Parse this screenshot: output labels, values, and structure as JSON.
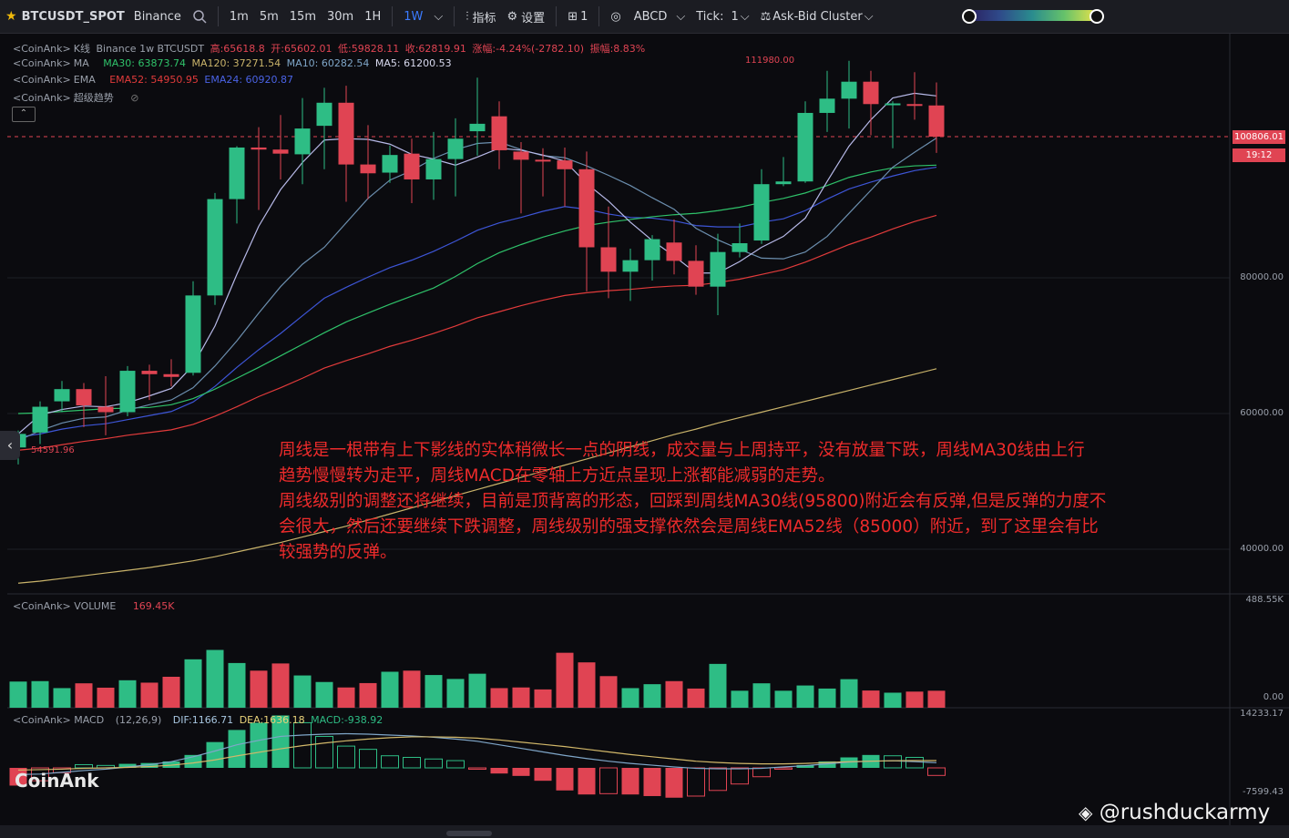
{
  "toolbar": {
    "symbol": "BTCUSDT_SPOT",
    "exchange": "Binance",
    "intervals": [
      "1m",
      "5m",
      "15m",
      "30m",
      "1H",
      "1W"
    ],
    "active_interval": "1W",
    "indicators_label": "指标",
    "settings_label": "设置",
    "layout_count": "1",
    "drawing_label": "ABCD",
    "tick_label": "Tick:",
    "tick_value": "1",
    "cluster_label": "Ask-Bid Cluster"
  },
  "legend": {
    "kline": {
      "prefix": "<CoinAnk>",
      "name": "K线",
      "desc": "Binance 1w BTCUSDT",
      "high": "高:65618.8",
      "open": "开:65602.01",
      "low": "低:59828.11",
      "close": "收:62819.91",
      "change": "涨幅:-4.24%(-2782.10)",
      "amp": "振幅:8.83%"
    },
    "ma": {
      "prefix": "<CoinAnk>",
      "name": "MA",
      "ma30": "MA30: 63873.74",
      "ma120": "MA120: 37271.54",
      "ma10": "MA10: 60282.54",
      "ma5": "MA5: 61200.53"
    },
    "ema": {
      "prefix": "<CoinAnk>",
      "name": "EMA",
      "ema52": "EMA52: 54950.95",
      "ema24": "EMA24: 60920.87"
    },
    "supertrend": {
      "prefix": "<CoinAnk>",
      "name": "超级趋势"
    }
  },
  "colors": {
    "up": "#2ebd85",
    "down": "#e04453",
    "ma5": "#b7b9e8",
    "ma10": "#6c8faf",
    "ma30": "#2fc26a",
    "ma120": "#c9b36a",
    "ema52": "#e23b3b",
    "ema24": "#3d55d6",
    "dif": "#7fa6c8",
    "dea": "#d2b86a"
  },
  "price_axis": {
    "labels": [
      "80000.00",
      "60000.00",
      "40000.00"
    ],
    "current_price": "100806.01",
    "countdown": "19:12",
    "high_marker": "111980.00",
    "low_marker": "54591.96"
  },
  "volume": {
    "label": "<CoinAnk> VOLUME",
    "value": "169.45K",
    "axis_top": "488.55K",
    "axis_bottom": "0.00"
  },
  "macd": {
    "label": "<CoinAnk> MACD",
    "params": "(12,26,9)",
    "dif": "DIF:1166.71",
    "dea": "DEA:1636.18",
    "macd": "MACD:-938.92",
    "axis_top": "14233.17",
    "axis_bottom": "-7599.43"
  },
  "watermark": "CoinAnk",
  "credit": "@rushduckarmy",
  "note": [
    "周线是一根带有上下影线的实体稍微长一点的阴线，成交量与上周持平，没有放量下跌，周线MA30线由上行",
    "趋势慢慢转为走平，周线MACD在零轴上方近点呈现上涨都能减弱的走势。",
    "周线级别的调整还将继续，目前是顶背离的形态，回踩到周线MA30线(95800)附近会有反弹,但是反弹的力度不",
    "会很大，然后还要继续下跌调整，周线级别的强支撑依然会是周线EMA52线（85000）附近，到了这里会有比",
    "较强势的反弹。"
  ],
  "chart_data": {
    "type": "candlestick",
    "price_range": [
      28000,
      115000
    ],
    "candles": [
      {
        "o": 55000,
        "h": 57500,
        "l": 52500,
        "c": 57000
      },
      {
        "o": 57200,
        "h": 61800,
        "l": 55500,
        "c": 61000
      },
      {
        "o": 61800,
        "h": 64800,
        "l": 60200,
        "c": 63600
      },
      {
        "o": 63600,
        "h": 64500,
        "l": 58000,
        "c": 61200
      },
      {
        "o": 61000,
        "h": 65500,
        "l": 56800,
        "c": 60200
      },
      {
        "o": 60200,
        "h": 67000,
        "l": 59600,
        "c": 66300
      },
      {
        "o": 66300,
        "h": 67200,
        "l": 62000,
        "c": 65800
      },
      {
        "o": 65800,
        "h": 68000,
        "l": 64000,
        "c": 65400
      },
      {
        "o": 66000,
        "h": 79500,
        "l": 65600,
        "c": 77400
      },
      {
        "o": 77400,
        "h": 92500,
        "l": 76000,
        "c": 91600
      },
      {
        "o": 91600,
        "h": 99400,
        "l": 88000,
        "c": 99200
      },
      {
        "o": 99200,
        "h": 102200,
        "l": 90000,
        "c": 98900
      },
      {
        "o": 98900,
        "h": 104000,
        "l": 94500,
        "c": 98300
      },
      {
        "o": 98200,
        "h": 106500,
        "l": 93800,
        "c": 102000
      },
      {
        "o": 102400,
        "h": 108000,
        "l": 96000,
        "c": 105800
      },
      {
        "o": 105800,
        "h": 108300,
        "l": 91200,
        "c": 96700
      },
      {
        "o": 96700,
        "h": 102500,
        "l": 91600,
        "c": 95400
      },
      {
        "o": 95500,
        "h": 99500,
        "l": 94000,
        "c": 98100
      },
      {
        "o": 98300,
        "h": 100500,
        "l": 91000,
        "c": 94500
      },
      {
        "o": 94500,
        "h": 101500,
        "l": 91500,
        "c": 97500
      },
      {
        "o": 97500,
        "h": 103500,
        "l": 92000,
        "c": 100500
      },
      {
        "o": 101600,
        "h": 109500,
        "l": 98000,
        "c": 102700
      },
      {
        "o": 103800,
        "h": 106000,
        "l": 96000,
        "c": 98800
      },
      {
        "o": 98600,
        "h": 100000,
        "l": 89500,
        "c": 97400
      },
      {
        "o": 97400,
        "h": 99100,
        "l": 92000,
        "c": 97300
      },
      {
        "o": 97300,
        "h": 99200,
        "l": 90500,
        "c": 96000
      },
      {
        "o": 96000,
        "h": 98600,
        "l": 78000,
        "c": 84500
      },
      {
        "o": 84500,
        "h": 90500,
        "l": 77000,
        "c": 80900
      },
      {
        "o": 80900,
        "h": 84300,
        "l": 76600,
        "c": 82600
      },
      {
        "o": 82600,
        "h": 86300,
        "l": 79600,
        "c": 85700
      },
      {
        "o": 85200,
        "h": 88600,
        "l": 80500,
        "c": 82500
      },
      {
        "o": 82500,
        "h": 84800,
        "l": 77500,
        "c": 78700
      },
      {
        "o": 78700,
        "h": 86500,
        "l": 74500,
        "c": 83800
      },
      {
        "o": 83800,
        "h": 88000,
        "l": 83000,
        "c": 85100
      },
      {
        "o": 85500,
        "h": 96000,
        "l": 85000,
        "c": 93800
      },
      {
        "o": 93800,
        "h": 97800,
        "l": 93500,
        "c": 94200
      },
      {
        "o": 94200,
        "h": 106000,
        "l": 94000,
        "c": 104300
      },
      {
        "o": 104300,
        "h": 110500,
        "l": 101500,
        "c": 106400
      },
      {
        "o": 106400,
        "h": 111980,
        "l": 102000,
        "c": 108900
      },
      {
        "o": 108900,
        "h": 110500,
        "l": 101000,
        "c": 105600
      },
      {
        "o": 105600,
        "h": 106000,
        "l": 99100,
        "c": 105700
      },
      {
        "o": 105600,
        "h": 110300,
        "l": 103300,
        "c": 105400
      },
      {
        "o": 105400,
        "h": 108800,
        "l": 98400,
        "c": 100806
      }
    ],
    "ma5": [
      57000,
      59800,
      60600,
      61100,
      61000,
      61600,
      62600,
      63700,
      67100,
      72900,
      80500,
      87600,
      93000,
      97000,
      100300,
      100500,
      100400,
      99700,
      98200,
      97500,
      96600,
      97800,
      99100,
      98800,
      98100,
      97200,
      93900,
      91300,
      88200,
      85500,
      83200,
      80700,
      80700,
      82400,
      84500,
      86100,
      88800,
      94200,
      99400,
      103300,
      106500,
      107200,
      106800
    ],
    "ma10": [
      56000,
      57500,
      58600,
      59300,
      59500,
      60500,
      61300,
      62000,
      63800,
      67000,
      70700,
      74800,
      78700,
      82000,
      84500,
      88100,
      91700,
      94400,
      95800,
      97600,
      98900,
      99800,
      100000,
      98900,
      98000,
      97700,
      96500,
      95100,
      93600,
      91800,
      90100,
      87300,
      85600,
      84200,
      82900,
      82800,
      83800,
      86100,
      89500,
      92900,
      96300,
      98500,
      100600
    ],
    "ma30": [
      60000,
      60100,
      60300,
      60500,
      60700,
      60800,
      60900,
      61300,
      62200,
      63600,
      65200,
      66800,
      68500,
      70200,
      71900,
      73500,
      74800,
      76100,
      77300,
      78500,
      80200,
      82100,
      83700,
      84900,
      86000,
      86900,
      87700,
      88200,
      88600,
      89000,
      89300,
      89500,
      89900,
      90400,
      91100,
      91700,
      92500,
      93600,
      94800,
      95600,
      96200,
      96500,
      96600
    ],
    "ma120": [
      35000,
      35300,
      35700,
      36100,
      36500,
      36900,
      37300,
      37800,
      38300,
      38900,
      39600,
      40300,
      41000,
      41800,
      42600,
      43400,
      44300,
      45200,
      46100,
      47000,
      47900,
      48800,
      49700,
      50600,
      51500,
      52400,
      53300,
      54200,
      55100,
      56000,
      56900,
      57700,
      58600,
      59400,
      60200,
      61000,
      61800,
      62600,
      63400,
      64200,
      65000,
      65800,
      66600
    ],
    "ema52": [
      54600,
      54900,
      55400,
      55900,
      56300,
      56800,
      57200,
      57600,
      58400,
      59600,
      61000,
      62500,
      63800,
      65200,
      66700,
      67800,
      68800,
      69900,
      70800,
      71800,
      72900,
      74100,
      75000,
      75900,
      76700,
      77400,
      77800,
      78100,
      78300,
      78600,
      78800,
      78900,
      79300,
      79800,
      80500,
      81200,
      82300,
      83600,
      84900,
      86000,
      87200,
      88300,
      89200
    ],
    "ema24": [
      56500,
      57000,
      57700,
      58200,
      58500,
      59100,
      59700,
      60300,
      61700,
      64000,
      66800,
      69400,
      71800,
      74400,
      77000,
      78600,
      80100,
      81500,
      82600,
      83900,
      85400,
      87000,
      88100,
      88900,
      89800,
      90500,
      90100,
      89400,
      88900,
      88800,
      88400,
      87700,
      87500,
      87500,
      88200,
      88700,
      89900,
      91600,
      93100,
      94100,
      95000,
      95800,
      96300
    ],
    "volume": [
      120000,
      122000,
      90000,
      112000,
      92000,
      126000,
      115000,
      142000,
      222000,
      265000,
      205000,
      170000,
      203000,
      148000,
      118000,
      93000,
      113000,
      165000,
      170000,
      150000,
      132000,
      156000,
      90000,
      93000,
      84000,
      252000,
      208000,
      145000,
      90000,
      108000,
      122000,
      88000,
      201000,
      78000,
      112000,
      78000,
      102000,
      88000,
      131000,
      79000,
      69000,
      74000,
      78000
    ],
    "macd_hist": [
      -2200,
      -1600,
      -600,
      400,
      300,
      500,
      600,
      800,
      1600,
      3200,
      4700,
      5600,
      6500,
      5600,
      3900,
      2700,
      2300,
      1500,
      1300,
      1100,
      900,
      -150,
      -700,
      -1000,
      -1600,
      -2800,
      -3300,
      -3200,
      -3300,
      -3500,
      -3700,
      -3500,
      -2800,
      -2000,
      -1100,
      -150,
      350,
      800,
      1300,
      1600,
      1500,
      1300,
      -939
    ],
    "dif": [
      -1500,
      -1400,
      -1000,
      -600,
      -300,
      200,
      700,
      1400,
      2500,
      3800,
      5200,
      6200,
      7100,
      7400,
      7600,
      7700,
      7600,
      7400,
      7200,
      6900,
      6500,
      6000,
      5200,
      4400,
      3600,
      2800,
      2100,
      1500,
      1000,
      600,
      200,
      -100,
      -200,
      -200,
      -100,
      200,
      500,
      900,
      1300,
      1500,
      1600,
      1400,
      1167
    ],
    "dea": [
      -500,
      -400,
      -300,
      -100,
      0,
      100,
      300,
      600,
      1100,
      1800,
      2700,
      3500,
      4300,
      5000,
      5600,
      6100,
      6500,
      6800,
      7000,
      7000,
      6900,
      6700,
      6300,
      5800,
      5300,
      4800,
      4200,
      3600,
      3000,
      2500,
      2000,
      1500,
      1200,
      1000,
      900,
      900,
      1000,
      1200,
      1400,
      1500,
      1600,
      1650,
      1636
    ]
  }
}
